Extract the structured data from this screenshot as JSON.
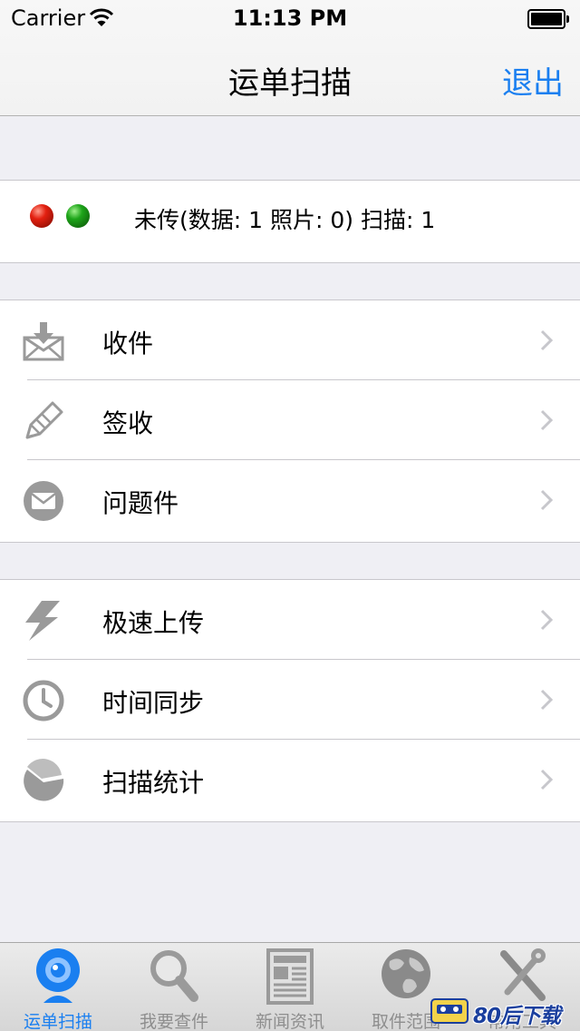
{
  "status_bar": {
    "carrier": "Carrier",
    "time": "11:13 PM"
  },
  "nav": {
    "title": "运单扫描",
    "right_button": "退出"
  },
  "upload_status": {
    "text": "未传(数据: 1 照片: 0)  扫描: 1",
    "indicator_colors": [
      "#e32010",
      "#1ea51a"
    ]
  },
  "menu_group_1": [
    {
      "label": "收件",
      "icon": "inbox-envelope-icon"
    },
    {
      "label": "签收",
      "icon": "pen-icon"
    },
    {
      "label": "问题件",
      "icon": "envelope-circle-icon"
    }
  ],
  "menu_group_2": [
    {
      "label": "极速上传",
      "icon": "lightning-icon"
    },
    {
      "label": "时间同步",
      "icon": "clock-icon"
    },
    {
      "label": "扫描统计",
      "icon": "pie-chart-icon"
    }
  ],
  "tabs": [
    {
      "label": "运单扫描",
      "icon": "webcam-icon",
      "active": true
    },
    {
      "label": "我要查件",
      "icon": "magnifier-icon",
      "active": false
    },
    {
      "label": "新闻资讯",
      "icon": "newspaper-icon",
      "active": false
    },
    {
      "label": "取件范围",
      "icon": "globe-icon",
      "active": false
    },
    {
      "label": "常用工具",
      "icon": "tools-icon",
      "active": false
    }
  ],
  "watermark": {
    "text": "80后下载"
  },
  "colors": {
    "accent": "#1a7ff0",
    "icon_gray": "#9a9a9a",
    "background": "#efeff4"
  }
}
